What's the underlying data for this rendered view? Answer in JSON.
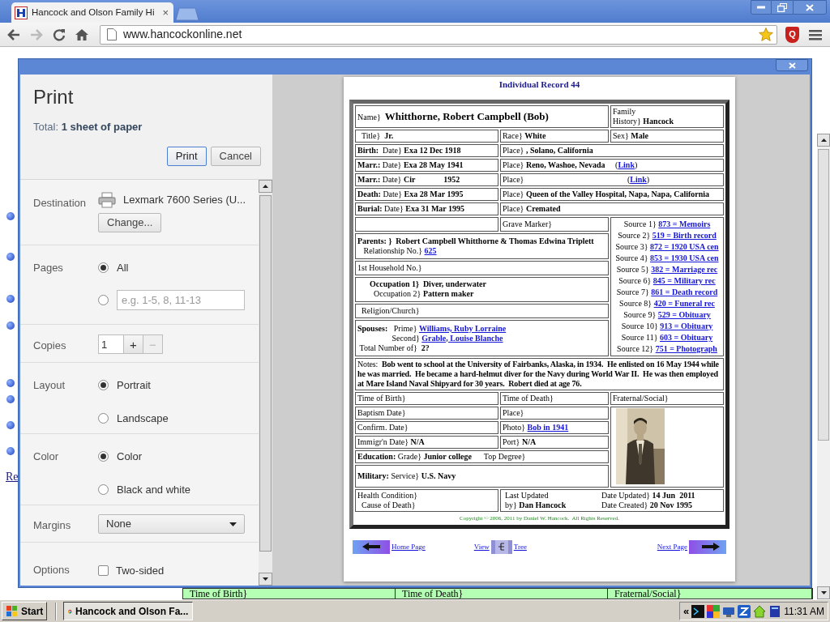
{
  "browser": {
    "tab_title": "Hancock and Olson Family Hi",
    "tab_close": "×",
    "url": "www.hancockonline.net",
    "extension_label": "Q"
  },
  "page_behind": {
    "link": "Re",
    "row": [
      "Time of Birth}",
      "Time of Death}",
      "Fraternal/Social}"
    ]
  },
  "print_dialog": {
    "title": "Print",
    "total": "Total: **1 sheet of paper**",
    "buttons": [
      {
        "label": "Print",
        "primary": true
      },
      {
        "label": "Cancel",
        "primary": false
      }
    ],
    "settings": [
      {
        "kind": "destination",
        "label": "Destination",
        "printer": "Lexmark 7600 Series (U...",
        "button": "Change..."
      },
      {
        "kind": "radios",
        "label": "Pages",
        "options": [
          {
            "label": "All",
            "selected": true
          },
          {
            "placeholder": "e.g. 1-5, 8, 11-13",
            "selected": false
          }
        ]
      },
      {
        "kind": "stepper",
        "label": "Copies",
        "value": "1",
        "plus": "+",
        "minus": "−",
        "minus_disabled": true
      },
      {
        "kind": "radios",
        "label": "Layout",
        "options": [
          {
            "label": "Portrait",
            "selected": true
          },
          {
            "label": "Landscape",
            "selected": false
          }
        ]
      },
      {
        "kind": "radios",
        "label": "Color",
        "options": [
          {
            "label": "Color",
            "selected": true
          },
          {
            "label": "Black and white",
            "selected": false
          }
        ]
      },
      {
        "kind": "select",
        "label": "Margins",
        "value": "None"
      },
      {
        "kind": "checkbox",
        "label": "Options",
        "option": "Two-sided",
        "checked": false
      }
    ]
  },
  "preview": {
    "heading": "Individual Record 44",
    "rows": [
      [
        {
          "colspan": 2,
          "kind": "name",
          "lines": [
            {
              "text": "Name}  **Whitthorne, Robert Campbell (Bob)**"
            }
          ]
        },
        {
          "lines": [
            {
              "text": "Family"
            },
            {
              "text": "History} **Hancock**"
            }
          ]
        }
      ],
      [
        {
          "lines": [
            {
              "text": "  Title}  **Jr.**"
            }
          ]
        },
        {
          "lines": [
            {
              "text": "Race} **White**"
            }
          ]
        },
        {
          "lines": [
            {
              "text": "Sex} **Male**"
            }
          ]
        }
      ],
      [
        {
          "lines": [
            {
              "text": "**Birth:**  Date} **Exa 12 Dec 1918**"
            }
          ]
        },
        {
          "colspan": 2,
          "lines": [
            {
              "text": "Place} **, Solano, California**"
            }
          ]
        }
      ],
      [
        {
          "lines": [
            {
              "text": "**Marr.:** Date} **Exa 28 May 1941**"
            }
          ]
        },
        {
          "colspan": 2,
          "lines": [
            {
              "text": "Place} **Reno, Washoe, Nevada**     (",
              "link": "Link",
              "after": ")"
            }
          ]
        }
      ],
      [
        {
          "lines": [
            {
              "text": "**Marr.:** Date} **Cir              1952**"
            }
          ]
        },
        {
          "colspan": 2,
          "lines": [
            {
              "text": "Place}                                                   (",
              "link": "Link",
              "after": ")"
            }
          ]
        }
      ],
      [
        {
          "lines": [
            {
              "text": "**Death:** Date} **Exa 28 Mar 1995**"
            }
          ]
        },
        {
          "colspan": 2,
          "lines": [
            {
              "text": "Place} **Queen of the Valley Hospital, Napa, Napa, California**"
            }
          ]
        }
      ],
      [
        {
          "lines": [
            {
              "text": "**Burial:** Date} **Exa 31 Mar 1995**"
            }
          ]
        },
        {
          "colspan": 2,
          "lines": [
            {
              "text": "Place} **Cremated**"
            }
          ]
        }
      ],
      [
        {},
        {
          "lines": [
            {
              "text": "Grave Marker}"
            }
          ]
        },
        {
          "rowspan": 6,
          "kind": "sources",
          "lines": [
            {
              "text": "Source 1} ",
              "link": "873 = Memoirs"
            },
            {
              "text": "Source 2} ",
              "link": "519 = Birth record"
            },
            {
              "text": "Source 3} ",
              "link": "872 = 1920 USA cen"
            },
            {
              "text": "Source 4} ",
              "link": "853 = 1930 USA cen"
            },
            {
              "text": "Source 5} ",
              "link": "382 = Marriage rec"
            },
            {
              "text": "Source 6} ",
              "link": "845 = Military rec"
            },
            {
              "text": "Source 7} ",
              "link": "861 = Death record"
            },
            {
              "text": "Source 8} ",
              "link": "420 = Funeral rec"
            },
            {
              "text": "Source 9} ",
              "link": "529 = Obituary"
            },
            {
              "text": "Source 10} ",
              "link": "913 = Obituary"
            },
            {
              "text": "Source 11} ",
              "link": "603 = Obituary"
            },
            {
              "text": "Source 12} ",
              "link": "751 = Photograph"
            }
          ]
        }
      ],
      [
        {
          "colspan": 2,
          "lines": [
            {
              "text": "**Parents: }  Robert Campbell Whitthorne & Thomas Edwina Triplett**"
            },
            {
              "text": "   Relationship No.} ",
              "link": "625"
            }
          ]
        }
      ],
      [
        {
          "colspan": 2,
          "lines": [
            {
              "text": "1st Household No.}"
            }
          ]
        }
      ],
      [
        {
          "colspan": 2,
          "lines": [
            {
              "text": "      **Occupation 1}  Diver, underwater**"
            },
            {
              "text": "        Occupation 2} **Pattern maker**"
            }
          ]
        }
      ],
      [
        {
          "colspan": 2,
          "lines": [
            {
              "text": "  Religion/Church}"
            }
          ]
        }
      ],
      [
        {
          "colspan": 2,
          "lines": [
            {
              "text": "**Spouses:**   Prime} ",
              "link": "Williams, Ruby Lorraine"
            },
            {
              "text": "                 Second} ",
              "link": "Grable, Louise Blanche"
            },
            {
              "text": " Total Number of}  **2?**"
            }
          ]
        }
      ],
      [
        {
          "colspan": 3,
          "kind": "notes",
          "lines": [
            {
              "text": "Notes:  **Bob went to school at the University of Fairbanks, Alaska, in 1934.  He enlisted on 16 May 1944 while he was married.  He became a hard-helmut diver for the Navy during World War II.  He was then employed at Mare Island Naval Shipyard for 30 years.  Robert died at age 76.**"
            }
          ]
        }
      ],
      [
        {
          "lines": [
            {
              "text": "Time of Birth}"
            }
          ]
        },
        {
          "lines": [
            {
              "text": "Time of Death}"
            }
          ]
        },
        {
          "lines": [
            {
              "text": "Fraternal/Social}"
            }
          ]
        }
      ],
      [
        {
          "lines": [
            {
              "text": "Baptism Date}"
            }
          ]
        },
        {
          "lines": [
            {
              "text": "Place}"
            }
          ]
        },
        {
          "rowspan": 5,
          "kind": "picture"
        }
      ],
      [
        {
          "lines": [
            {
              "text": "Confirm. Date}"
            }
          ]
        },
        {
          "lines": [
            {
              "text": "Photo} ",
              "link": "Bob in 1941"
            }
          ]
        }
      ],
      [
        {
          "lines": [
            {
              "text": "Immigr'n Date} **N/A**"
            }
          ]
        },
        {
          "lines": [
            {
              "text": "Port} **N/A**"
            }
          ]
        }
      ],
      [
        {
          "colspan": 2,
          "lines": [
            {
              "text": "**Education:** Grade} **Junior college**      Top Degree}"
            }
          ]
        }
      ],
      [
        {
          "colspan": 2,
          "kind": "tall",
          "lines": [
            {
              "text": "**Military:** Service} **U.S. Navy**"
            }
          ]
        }
      ],
      [
        {
          "lines": [
            {
              "text": "Health Condition}"
            },
            {
              "text": "  Cause of Death}"
            }
          ]
        },
        {
          "colspan": 2,
          "blocks": [
            [
              {
                "text": "Last Updated"
              },
              {
                "text": "by} **Dan Hancock**"
              }
            ],
            [
              {
                "text": "Date Updated} **14 Jun  2011**"
              },
              {
                "text": "Date Created} **20 Nov 1995**"
              }
            ]
          ]
        }
      ],
      [
        {
          "colspan": 3,
          "kind": "copyright",
          "lines": [
            {
              "text": "Copyright © 2006, 2011 by Daniel W. Hancock.  All Rights Reserved."
            }
          ]
        }
      ]
    ],
    "nav": {
      "home": "Home Page",
      "view": "View",
      "tree": "Tree",
      "next": "Next Page"
    }
  },
  "taskbar": {
    "start": "Start",
    "task": "Hancock and Olson Fa...",
    "tray_chevron": "«",
    "time": "11:31 AM"
  }
}
